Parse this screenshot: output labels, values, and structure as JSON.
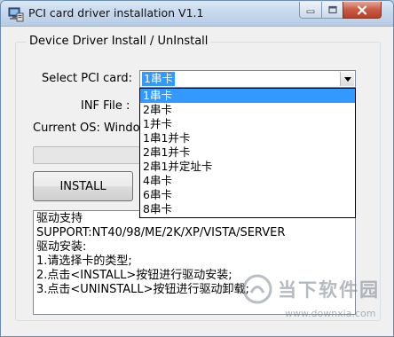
{
  "window": {
    "title": "PCI card driver installation V1.1"
  },
  "group": {
    "title": "Device Driver Install / UnInstall"
  },
  "form": {
    "select_label": "Select PCI card:",
    "select_value": "1串卡",
    "inf_label": "INF File :",
    "os_label": "Current OS: Windo"
  },
  "dropdown": {
    "options": [
      "1串卡",
      "2串卡",
      "1并卡",
      "1串1并卡",
      "2串1并卡",
      "2串1并定址卡",
      "4串卡",
      "6串卡",
      "8串卡"
    ],
    "selected_index": 0
  },
  "progress": {
    "value": 0
  },
  "buttons": {
    "install": "INSTALL"
  },
  "memo": {
    "lines": [
      "驱动支持",
      "SUPPORT:NT40/98/ME/2K/XP/VISTA/SERVER",
      "驱动安装:",
      "1.请选择卡的类型;",
      "2.点击<INSTALL>按钮进行驱动安装;",
      "3.点击<UNINSTALL>按钮进行驱动卸载;"
    ]
  },
  "watermark": {
    "name": "当下软件园",
    "url": "www.downxia.com"
  },
  "colors": {
    "selection": "#3399ff",
    "close_button": "#c85b45",
    "titlebar": "#c3d6ec"
  }
}
